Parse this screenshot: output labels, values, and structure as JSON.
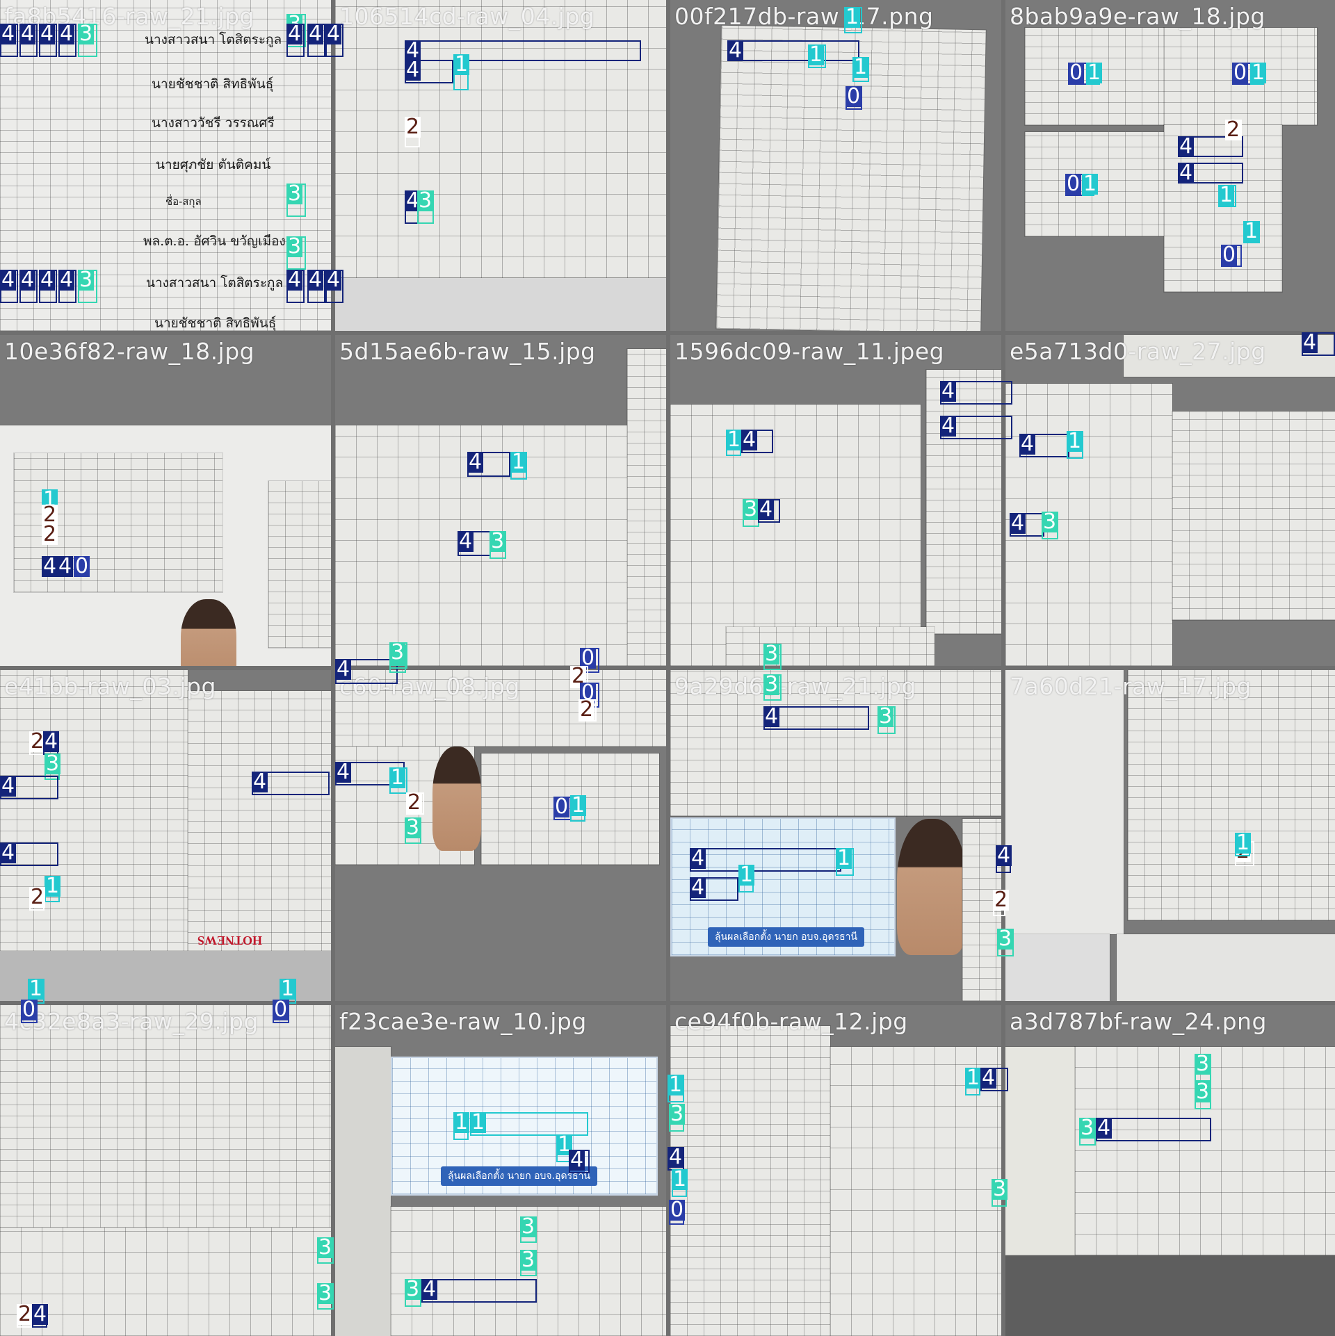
{
  "tiles": [
    {
      "title": "fa8b5416-raw_21.jpg",
      "names": [
        "นางสาวสนา โตสิตระกูล",
        "นายชัชชาติ สิทธิพันธุ์",
        "นางสาววัชรี วรรณศรี",
        "นายศุภชัย ตันติคมน์",
        "ชื่อ-สกุล",
        "พล.ต.อ. อัศวิน ขวัญเมือง",
        "นางสาวสนา โตสิตระกูล",
        "นายชัชชาติ สิทธิพันธุ์"
      ]
    },
    {
      "title": "106514cd-raw_04.jpg"
    },
    {
      "title": "00f217db-raw_17.png"
    },
    {
      "title": "8bab9a9e-raw_18.jpg"
    },
    {
      "title": "10e36f82-raw_18.jpg"
    },
    {
      "title": "5d15ae6b-raw_15.jpg"
    },
    {
      "title": "1596dc09-raw_11.jpeg"
    },
    {
      "title": "e5a713d0-raw_27.jpg"
    },
    {
      "title": "e41bb-raw_03.jpg",
      "logo": "HOTNEWS"
    },
    {
      "title": "c60-raw_08.jpg"
    },
    {
      "title": "9a29d65-raw_21.jpg",
      "banner": "ลุ้นผลเลือกตั้ง นายก อบจ.อุดรธานี"
    },
    {
      "title": "7a60d21-raw_17.jpg"
    },
    {
      "title": "4c32e8a3-raw_29.jpg"
    },
    {
      "title": "f23cae3e-raw_10.jpg",
      "banner": "ลุ้นผลเลือกตั้ง นายก อบจ.อุดรธานี"
    },
    {
      "title": "ce94f0b-raw_12.jpg"
    },
    {
      "title": "a3d787bf-raw_24.png"
    }
  ],
  "classes": {
    "0": {
      "color": "#2a3da8"
    },
    "1": {
      "color": "#23c9cf"
    },
    "2": {
      "color": "#ffffff"
    },
    "3": {
      "color": "#35d6b2"
    },
    "4": {
      "color": "#14247a"
    }
  },
  "detections": [
    {
      "tile": 0,
      "items": [
        [
          "4",
          0,
          34,
          26,
          48
        ],
        [
          "4",
          28,
          34,
          26,
          48
        ],
        [
          "4",
          56,
          34,
          26,
          48
        ],
        [
          "4",
          84,
          34,
          26,
          48
        ],
        [
          "3",
          112,
          34,
          28,
          48
        ],
        [
          "3",
          412,
          20,
          28,
          48
        ],
        [
          "4",
          412,
          34,
          26,
          48
        ],
        [
          "4",
          442,
          34,
          26,
          48
        ],
        [
          "4",
          468,
          34,
          26,
          48
        ],
        [
          "3",
          412,
          264,
          28,
          48
        ],
        [
          "3",
          412,
          340,
          28,
          48
        ],
        [
          "4",
          0,
          388,
          26,
          48
        ],
        [
          "4",
          28,
          388,
          26,
          48
        ],
        [
          "4",
          56,
          388,
          26,
          48
        ],
        [
          "4",
          84,
          388,
          26,
          48
        ],
        [
          "3",
          112,
          388,
          28,
          48
        ],
        [
          "4",
          412,
          388,
          26,
          48
        ],
        [
          "4",
          442,
          388,
          26,
          48
        ],
        [
          "4",
          468,
          388,
          26,
          48
        ]
      ]
    },
    {
      "tile": 1,
      "items": [
        [
          "4",
          582,
          58,
          340,
          30
        ],
        [
          "4",
          582,
          86,
          70,
          34
        ],
        [
          "1",
          652,
          78,
          22,
          52
        ],
        [
          "2",
          582,
          168,
          22,
          44
        ],
        [
          "4",
          582,
          274,
          20,
          48
        ],
        [
          "3",
          600,
          274,
          24,
          48
        ]
      ]
    },
    {
      "tile": 2,
      "items": [
        [
          "4",
          1046,
          58,
          190,
          30
        ],
        [
          "1",
          1162,
          64,
          26,
          34
        ],
        [
          "1",
          1214,
          10,
          26,
          38
        ],
        [
          "1",
          1226,
          82,
          24,
          36
        ],
        [
          "0",
          1216,
          124,
          24,
          34
        ]
      ]
    },
    {
      "tile": 3,
      "items": [
        [
          "0",
          1536,
          90,
          36,
          32
        ],
        [
          "1",
          1562,
          90,
          20,
          32
        ],
        [
          "0",
          1772,
          90,
          36,
          32
        ],
        [
          "1",
          1798,
          90,
          20,
          32
        ],
        [
          "0",
          1532,
          250,
          30,
          32
        ],
        [
          "1",
          1556,
          250,
          18,
          32
        ],
        [
          "4",
          1694,
          196,
          94,
          30
        ],
        [
          "4",
          1694,
          234,
          94,
          30
        ],
        [
          "2",
          1762,
          172,
          24,
          30
        ],
        [
          "1",
          1752,
          266,
          26,
          32
        ],
        [
          "0",
          1756,
          352,
          30,
          32
        ],
        [
          "1",
          1788,
          318,
          24,
          32
        ]
      ]
    },
    {
      "tile": 4,
      "items": [
        [
          "1",
          60,
          704,
          22,
          28
        ],
        [
          "2",
          60,
          726,
          22,
          28
        ],
        [
          "2",
          60,
          754,
          22,
          28
        ],
        [
          "4",
          60,
          800,
          22,
          30
        ],
        [
          "4",
          82,
          800,
          22,
          30
        ],
        [
          "0",
          106,
          800,
          22,
          30
        ]
      ]
    },
    {
      "tile": 5,
      "items": [
        [
          "4",
          672,
          650,
          62,
          36
        ],
        [
          "1",
          734,
          650,
          24,
          40
        ],
        [
          "4",
          658,
          764,
          48,
          36
        ],
        [
          "3",
          704,
          764,
          24,
          40
        ],
        [
          "4",
          482,
          948,
          90,
          36
        ],
        [
          "3",
          560,
          928,
          24,
          40
        ]
      ]
    },
    {
      "tile": 6,
      "items": [
        [
          "4",
          1352,
          548,
          104,
          34
        ],
        [
          "4",
          1352,
          598,
          104,
          34
        ],
        [
          "1",
          1044,
          618,
          22,
          38
        ],
        [
          "4",
          1066,
          618,
          46,
          34
        ],
        [
          "3",
          1068,
          718,
          24,
          40
        ],
        [
          "4",
          1090,
          718,
          32,
          34
        ]
      ]
    },
    {
      "tile": 7,
      "items": [
        [
          "4",
          1466,
          624,
          72,
          34
        ],
        [
          "1",
          1534,
          620,
          24,
          40
        ],
        [
          "4",
          1452,
          738,
          50,
          34
        ],
        [
          "3",
          1498,
          736,
          24,
          40
        ],
        [
          "4",
          1872,
          478,
          48,
          34
        ]
      ]
    },
    {
      "tile": 8,
      "items": [
        [
          "2",
          42,
          1052,
          22,
          34
        ],
        [
          "4",
          62,
          1052,
          22,
          34
        ],
        [
          "3",
          64,
          1084,
          22,
          38
        ],
        [
          "4",
          0,
          1116,
          84,
          34
        ],
        [
          "4",
          362,
          1110,
          112,
          34
        ],
        [
          "4",
          0,
          1212,
          84,
          34
        ],
        [
          "1",
          64,
          1260,
          22,
          38
        ],
        [
          "2",
          42,
          1276,
          22,
          34
        ],
        [
          "1",
          40,
          1408,
          24,
          36
        ],
        [
          "0",
          30,
          1438,
          24,
          34
        ],
        [
          "1",
          402,
          1408,
          24,
          36
        ],
        [
          "0",
          392,
          1438,
          24,
          34
        ]
      ]
    },
    {
      "tile": 9,
      "items": [
        [
          "3",
          560,
          924,
          26,
          38
        ],
        [
          "0",
          834,
          932,
          28,
          36
        ],
        [
          "2",
          820,
          958,
          26,
          32
        ],
        [
          "0",
          834,
          982,
          28,
          36
        ],
        [
          "2",
          832,
          1006,
          26,
          32
        ],
        [
          "4",
          482,
          1096,
          100,
          34
        ],
        [
          "1",
          560,
          1104,
          26,
          38
        ],
        [
          "2",
          584,
          1140,
          26,
          32
        ],
        [
          "3",
          582,
          1176,
          24,
          38
        ],
        [
          "0",
          796,
          1146,
          26,
          34
        ],
        [
          "1",
          820,
          1144,
          22,
          38
        ]
      ]
    },
    {
      "tile": 10,
      "items": [
        [
          "3",
          1098,
          926,
          26,
          38
        ],
        [
          "3",
          1098,
          970,
          26,
          38
        ],
        [
          "4",
          1098,
          1016,
          152,
          34
        ],
        [
          "3",
          1262,
          1016,
          26,
          40
        ],
        [
          "4",
          992,
          1220,
          218,
          34
        ],
        [
          "1",
          1202,
          1220,
          26,
          40
        ],
        [
          "4",
          992,
          1262,
          70,
          34
        ],
        [
          "1",
          1062,
          1244,
          22,
          40
        ],
        [
          "4",
          1432,
          1216,
          22,
          40
        ]
      ]
    },
    {
      "tile": 11,
      "items": [
        [
          "2",
          1776,
          1210,
          28,
          36
        ],
        [
          "1",
          1776,
          1198,
          22,
          34
        ],
        [
          "3",
          1434,
          1336,
          24,
          40
        ],
        [
          "2",
          1428,
          1280,
          18,
          38
        ]
      ]
    },
    {
      "tile": 12,
      "items": [
        [
          "3",
          456,
          1780,
          24,
          38
        ],
        [
          "3",
          456,
          1846,
          24,
          38
        ],
        [
          "2",
          24,
          1876,
          22,
          34
        ],
        [
          "4",
          46,
          1876,
          22,
          34
        ]
      ]
    },
    {
      "tile": 13,
      "items": [
        [
          "1",
          652,
          1600,
          22,
          40
        ],
        [
          "1",
          676,
          1600,
          170,
          34
        ],
        [
          "1",
          800,
          1632,
          22,
          40
        ],
        [
          "4",
          818,
          1654,
          30,
          34
        ],
        [
          "3",
          748,
          1750,
          24,
          38
        ],
        [
          "3",
          748,
          1798,
          24,
          38
        ],
        [
          "3",
          582,
          1840,
          24,
          40
        ],
        [
          "4",
          606,
          1840,
          166,
          34
        ]
      ]
    },
    {
      "tile": 14,
      "items": [
        [
          "1",
          960,
          1546,
          24,
          40
        ],
        [
          "3",
          962,
          1588,
          22,
          40
        ],
        [
          "4",
          960,
          1650,
          24,
          34
        ],
        [
          "1",
          966,
          1682,
          22,
          40
        ],
        [
          "0",
          962,
          1726,
          22,
          36
        ],
        [
          "1",
          1388,
          1536,
          22,
          40
        ],
        [
          "4",
          1410,
          1536,
          40,
          34
        ],
        [
          "3",
          1426,
          1696,
          22,
          40
        ]
      ]
    },
    {
      "tile": 15,
      "items": [
        [
          "3",
          1718,
          1516,
          24,
          40
        ],
        [
          "3",
          1718,
          1556,
          24,
          40
        ],
        [
          "3",
          1552,
          1608,
          24,
          40
        ],
        [
          "4",
          1576,
          1608,
          166,
          34
        ]
      ]
    }
  ]
}
